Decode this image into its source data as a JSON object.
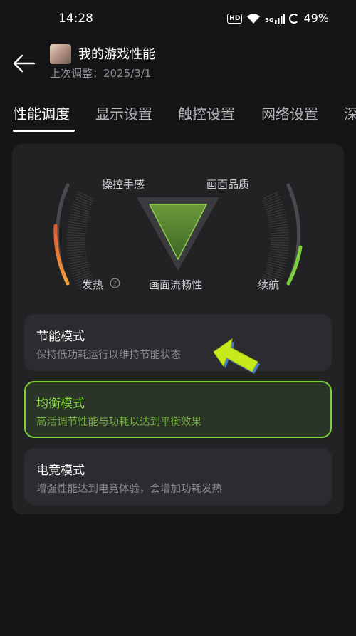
{
  "status_bar": {
    "time": "14:28",
    "network_badge": "HD",
    "cellular": "5G",
    "battery": "49%"
  },
  "header": {
    "title": "我的游戏性能",
    "subtitle": "上次调整：2025/3/1"
  },
  "tabs": [
    {
      "label": "性能调度",
      "active": true
    },
    {
      "label": "显示设置",
      "active": false
    },
    {
      "label": "触控设置",
      "active": false
    },
    {
      "label": "网络设置",
      "active": false
    },
    {
      "label": "深",
      "active": false
    }
  ],
  "chart": {
    "top_left_label": "操控手感",
    "top_right_label": "画面品质",
    "bottom_center_label": "画面流畅性",
    "heat_label": "发热",
    "battery_label": "续航",
    "heat_level": 0.45,
    "battery_level": 0.4
  },
  "modes": [
    {
      "title": "节能模式",
      "desc": "保持低功耗运行以维持节能状态",
      "selected": false
    },
    {
      "title": "均衡模式",
      "desc": "高活调节性能与功耗以达到平衡效果",
      "selected": true
    },
    {
      "title": "电竞模式",
      "desc": "增强性能达到电竞体验，会增加功耗发热",
      "selected": false
    }
  ],
  "colors": {
    "accent": "#7BD03C",
    "background": "#151517",
    "card": "#222225",
    "heat_high": "#E8572A",
    "heat_low": "#F2A33A"
  }
}
